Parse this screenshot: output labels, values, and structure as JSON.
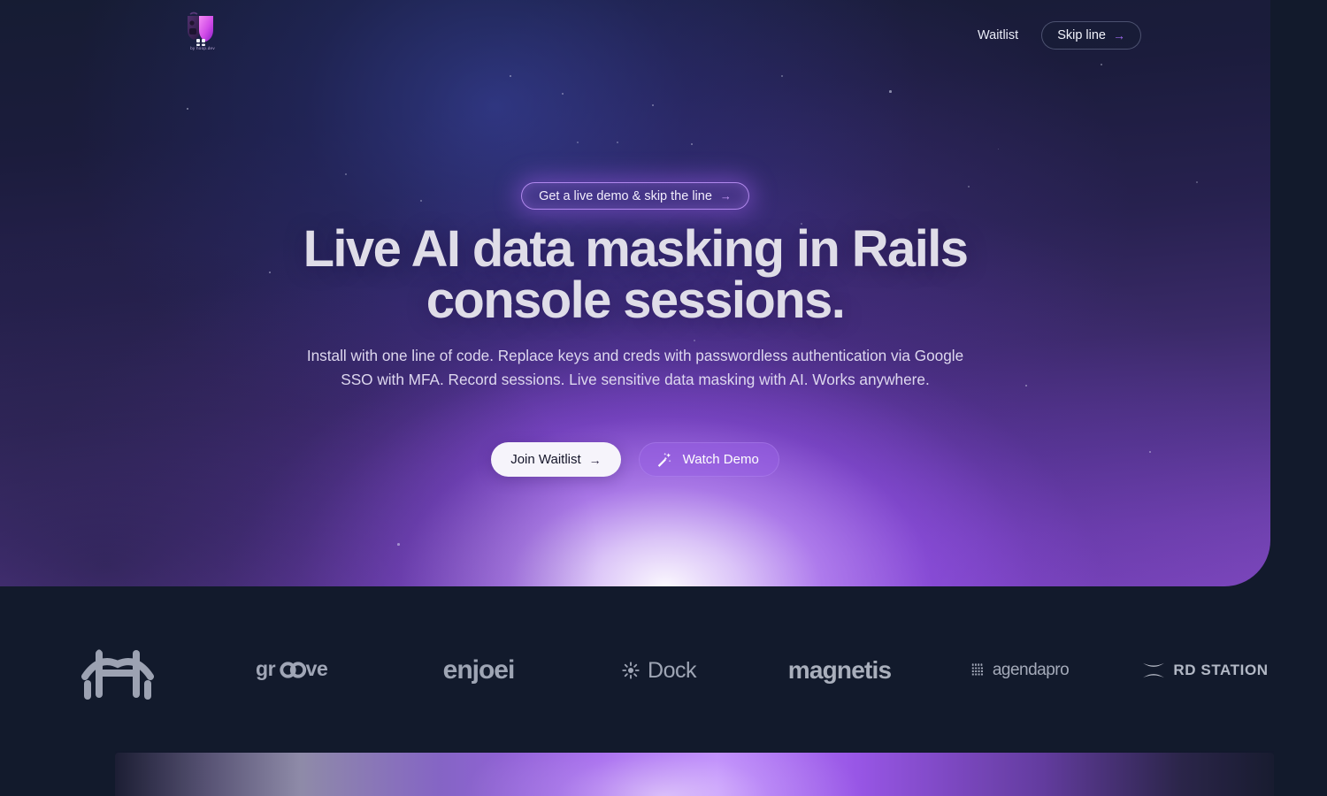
{
  "brand": {
    "name": "hoop",
    "tagline": "by hoop.dev",
    "logo_icon": "shield-mask-logo",
    "colors": {
      "shield_light": "#f07af0",
      "shield_dark": "#a22ad6",
      "mask_dark": "#3b2352"
    }
  },
  "nav": {
    "waitlist_label": "Waitlist",
    "skip_line_label": "Skip line",
    "skip_line_arrow": "→",
    "arrow_color": "#9f6af0"
  },
  "hero": {
    "badge": {
      "label": "Get a live demo & skip the line",
      "arrow": "→",
      "border_color": "#c496ff",
      "glow_color": "#a05ff0"
    },
    "headline_line1": "Live AI data masking in Rails",
    "headline_line2": "console sessions.",
    "subcopy": "Install with one line of code. Replace keys and creds with passwordless authentication via Google SSO with MFA. Record sessions. Live sensitive data masking with AI. Works anywhere.",
    "cta_primary": {
      "label": "Join Waitlist",
      "arrow": "→"
    },
    "cta_secondary": {
      "label": "Watch Demo",
      "icon": "magic-wand-icon"
    },
    "accent_color": "#9760e4",
    "panel_bg_top": "#161c33",
    "panel_bg_bottom": "#7d48bd"
  },
  "logos": {
    "items": [
      {
        "name": "bridge-logo",
        "label": ""
      },
      {
        "name": "groove-logo",
        "label": "groove"
      },
      {
        "name": "enjoei-logo",
        "label": "enjoei"
      },
      {
        "name": "dock-logo",
        "label": "Dock"
      },
      {
        "name": "magnetis-logo",
        "label": "magnetis"
      },
      {
        "name": "agendapro-logo",
        "label": "agendapro"
      },
      {
        "name": "rdstation-logo",
        "label": "RD STATION"
      }
    ]
  },
  "page": {
    "background_color": "#121a2c",
    "bottom_bar_accent": "#9e5ceb"
  }
}
